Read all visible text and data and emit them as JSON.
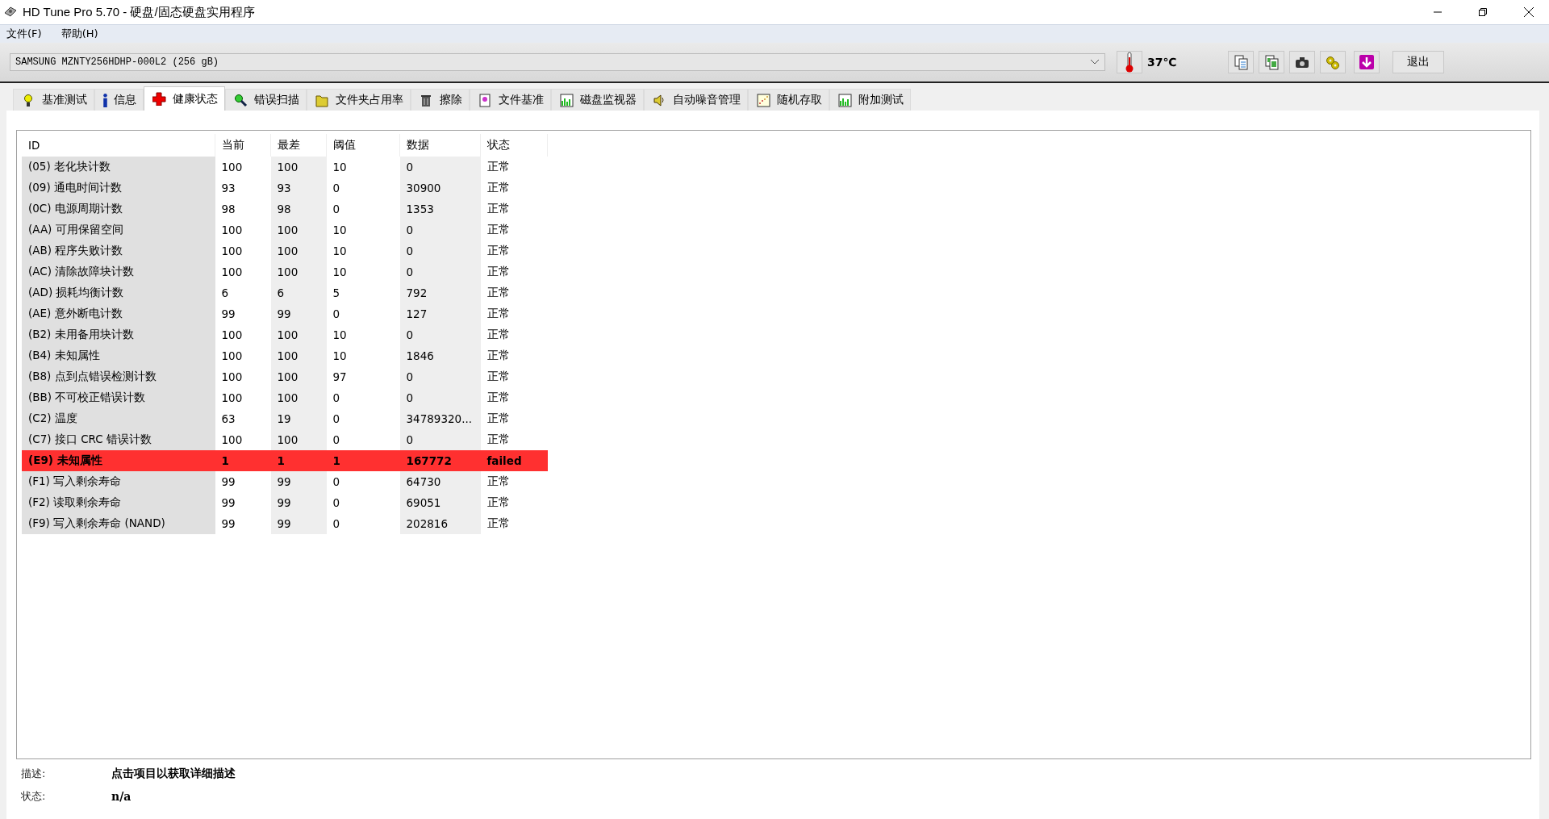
{
  "window": {
    "title": "HD Tune Pro 5.70 - 硬盘/固态硬盘实用程序"
  },
  "menu": [
    "文件(F)",
    "帮助(H)"
  ],
  "toolbar": {
    "drive": "SAMSUNG MZNTY256HDHP-000L2 (256 gB)",
    "temperature": "37℃",
    "tools": [
      {
        "kind": "copy-text"
      },
      {
        "kind": "copy-image"
      },
      {
        "kind": "camera"
      },
      {
        "kind": "gears"
      },
      {
        "kind": "download"
      }
    ],
    "exit": "退出"
  },
  "tabs": [
    {
      "label": "基准测试",
      "kind": "bulb",
      "selected": false
    },
    {
      "label": "信息",
      "kind": "info",
      "selected": false
    },
    {
      "label": "健康状态",
      "kind": "cross",
      "selected": true
    },
    {
      "label": "错误扫描",
      "kind": "magnifier",
      "selected": false
    },
    {
      "label": "文件夹占用率",
      "kind": "folder",
      "selected": false
    },
    {
      "label": "擦除",
      "kind": "bin",
      "selected": false
    },
    {
      "label": "文件基准",
      "kind": "file",
      "selected": false
    },
    {
      "label": "磁盘监视器",
      "kind": "chart",
      "selected": false
    },
    {
      "label": "自动噪音管理",
      "kind": "speaker",
      "selected": false
    },
    {
      "label": "随机存取",
      "kind": "dots",
      "selected": false
    },
    {
      "label": "附加测试",
      "kind": "chart",
      "selected": false
    }
  ],
  "table": {
    "columns": [
      "ID",
      "当前",
      "最差",
      "阈值",
      "数据",
      "状态"
    ],
    "rows": [
      {
        "cells": [
          "(05) 老化块计数",
          "100",
          "100",
          "10",
          "0",
          "正常"
        ],
        "critical": false
      },
      {
        "cells": [
          "(09) 通电时间计数",
          "93",
          "93",
          "0",
          "30900",
          "正常"
        ],
        "critical": false
      },
      {
        "cells": [
          "(0C) 电源周期计数",
          "98",
          "98",
          "0",
          "1353",
          "正常"
        ],
        "critical": false
      },
      {
        "cells": [
          "(AA) 可用保留空间",
          "100",
          "100",
          "10",
          "0",
          "正常"
        ],
        "critical": false
      },
      {
        "cells": [
          "(AB) 程序失败计数",
          "100",
          "100",
          "10",
          "0",
          "正常"
        ],
        "critical": false
      },
      {
        "cells": [
          "(AC) 清除故障块计数",
          "100",
          "100",
          "10",
          "0",
          "正常"
        ],
        "critical": false
      },
      {
        "cells": [
          "(AD) 损耗均衡计数",
          "6",
          "6",
          "5",
          "792",
          "正常"
        ],
        "critical": false
      },
      {
        "cells": [
          "(AE) 意外断电计数",
          "99",
          "99",
          "0",
          "127",
          "正常"
        ],
        "critical": false
      },
      {
        "cells": [
          "(B2) 未用备用块计数",
          "100",
          "100",
          "10",
          "0",
          "正常"
        ],
        "critical": false
      },
      {
        "cells": [
          "(B4) 未知属性",
          "100",
          "100",
          "10",
          "1846",
          "正常"
        ],
        "critical": false
      },
      {
        "cells": [
          "(B8) 点到点错误检测计数",
          "100",
          "100",
          "97",
          "0",
          "正常"
        ],
        "critical": false
      },
      {
        "cells": [
          "(BB) 不可校正错误计数",
          "100",
          "100",
          "0",
          "0",
          "正常"
        ],
        "critical": false
      },
      {
        "cells": [
          "(C2) 温度",
          "63",
          "19",
          "0",
          "34789320...",
          "正常"
        ],
        "critical": false
      },
      {
        "cells": [
          "(C7) 接口 CRC 错误计数",
          "100",
          "100",
          "0",
          "0",
          "正常"
        ],
        "critical": false
      },
      {
        "cells": [
          "(E9) 未知属性",
          "1",
          "1",
          "1",
          "167772",
          "failed"
        ],
        "critical": true
      },
      {
        "cells": [
          "(F1) 写入剩余寿命",
          "99",
          "99",
          "0",
          "64730",
          "正常"
        ],
        "critical": false
      },
      {
        "cells": [
          "(F2) 读取剩余寿命",
          "99",
          "99",
          "0",
          "69051",
          "正常"
        ],
        "critical": false
      },
      {
        "cells": [
          "(F9) 写入剩余寿命 (NAND)",
          "99",
          "99",
          "0",
          "202816",
          "正常"
        ],
        "critical": false
      }
    ]
  },
  "details": [
    {
      "label": "描述:",
      "value": "点击项目以获取详细描述"
    },
    {
      "label": "状态:",
      "value": "n/a"
    }
  ]
}
